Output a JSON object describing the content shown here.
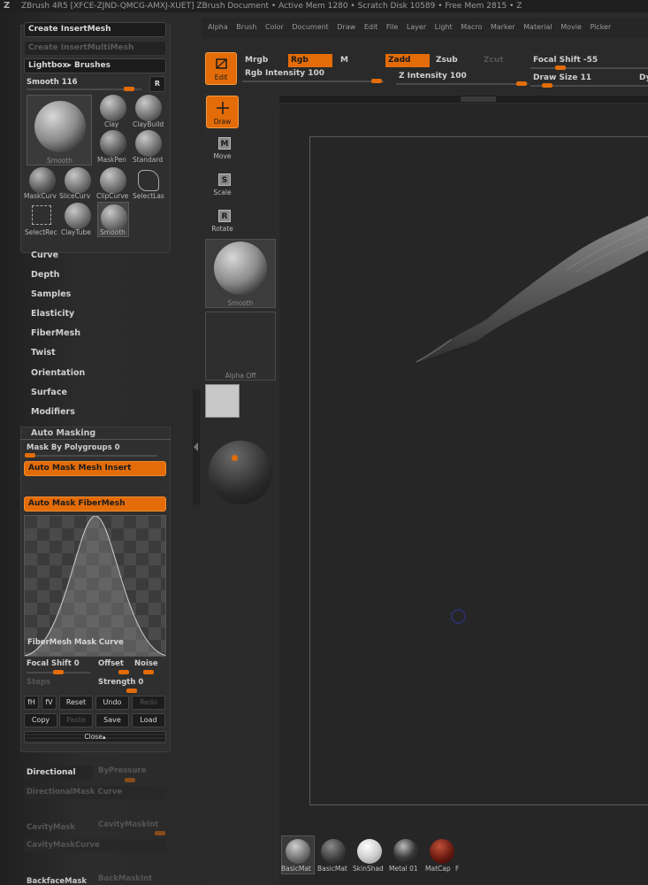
{
  "titlebar": {
    "logo": "Z",
    "text": "ZBrush 4R5 [XFCE-ZJND-QMCG-AMXJ-XUET]   ZBrush Document   • Active Mem 1280 • Scratch Disk 10589 • Free Mem 2815 • Z"
  },
  "menubar": {
    "items": [
      "Alpha",
      "Brush",
      "Color",
      "Document",
      "Draw",
      "Edit",
      "File",
      "Layer",
      "Light",
      "Macro",
      "Marker",
      "Material",
      "Movie",
      "Picker"
    ]
  },
  "brush_panel": {
    "create_insertmesh": "Create InsertMesh",
    "create_insertmultimesh": "Create InsertMultiMesh",
    "lightbox_brushes": "Lightbox▸ Brushes",
    "smooth_label": "Smooth",
    "smooth_value": "116",
    "r_button": "R",
    "current_brush": "Smooth",
    "brushes": [
      "Clay",
      "ClayBuild",
      "MaskPen",
      "Standard",
      "MaskCurv",
      "SliceCurv",
      "ClipCurve",
      "SelectLas",
      "SelectRec",
      "ClayTube",
      "Smooth"
    ]
  },
  "submenus": [
    "Curve",
    "Depth",
    "Samples",
    "Elasticity",
    "FiberMesh",
    "Twist",
    "Orientation",
    "Surface",
    "Modifiers"
  ],
  "automask": {
    "header": "Auto Masking",
    "mask_by_polygroups": "Mask By Polygroups 0",
    "auto_mask_mesh_insert": "Auto Mask Mesh Insert",
    "auto_mask_fibermesh": "Auto Mask FiberMesh",
    "curve_label": "FiberMesh Mask Curve",
    "focal_shift": "Focal Shift 0",
    "offset": "Offset",
    "noise": "Noise",
    "steps": "Steps",
    "strength": "Strength 0",
    "buttons_row1": [
      "fH",
      "fV",
      "Reset",
      "Undo",
      "Redo"
    ],
    "buttons_row2": [
      "Copy",
      "Paste",
      "Save",
      "Load"
    ],
    "close": "Close▴",
    "directional": "Directional",
    "bypressure": "ByPressure",
    "directional_mask_curve": "DirectionalMask Curve",
    "cavity_mask": "CavityMask",
    "cavity_mask_int": "CavityMaskInt",
    "cavity_mask_curve": "CavityMaskCurve",
    "backface_mask": "BackfaceMask",
    "back_mask_int": "BackMaskInt"
  },
  "shelf": {
    "mrgb": "Mrgb",
    "rgb": "Rgb",
    "m": "M",
    "rgb_intensity": "Rgb Intensity 100",
    "zadd": "Zadd",
    "zsub": "Zsub",
    "zcut": "Zcut",
    "z_intensity": "Z Intensity 100",
    "focal_shift": "Focal Shift -55",
    "draw_size": "Draw Size 11",
    "dy": "Dy"
  },
  "tools": {
    "edit": "Edit",
    "draw": "Draw",
    "move": "Move",
    "scale": "Scale",
    "rotate": "Rotate",
    "brush_slot": "Smooth",
    "alpha_slot": "Alpha Off"
  },
  "materials": [
    "BasicMat",
    "BasicMat",
    "SkinShad",
    "Metal 01",
    "MatCap",
    "F"
  ],
  "colors": {
    "accent": "#e36c09",
    "panel": "#2b2b2b",
    "canvas": "#262626"
  }
}
